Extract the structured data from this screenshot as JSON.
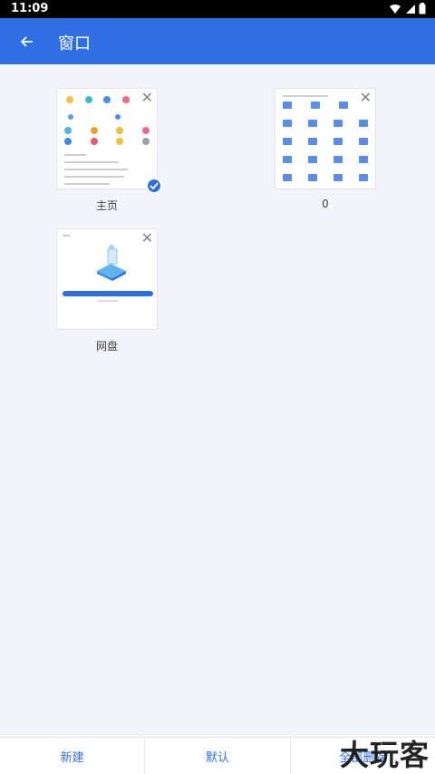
{
  "status_bar": {
    "time": "11:09"
  },
  "app_bar": {
    "title": "窗口"
  },
  "windows": [
    {
      "caption": "主页",
      "selected": true
    },
    {
      "caption": "0",
      "selected": false
    },
    {
      "caption": "网盘",
      "selected": false
    }
  ],
  "bottom_bar": {
    "new_label": "新建",
    "default_label": "默认",
    "delete_all_label": "全部删除"
  },
  "watermark": "大玩客",
  "colors": {
    "accent": "#2f6fe4",
    "background": "#f2f4f9"
  }
}
